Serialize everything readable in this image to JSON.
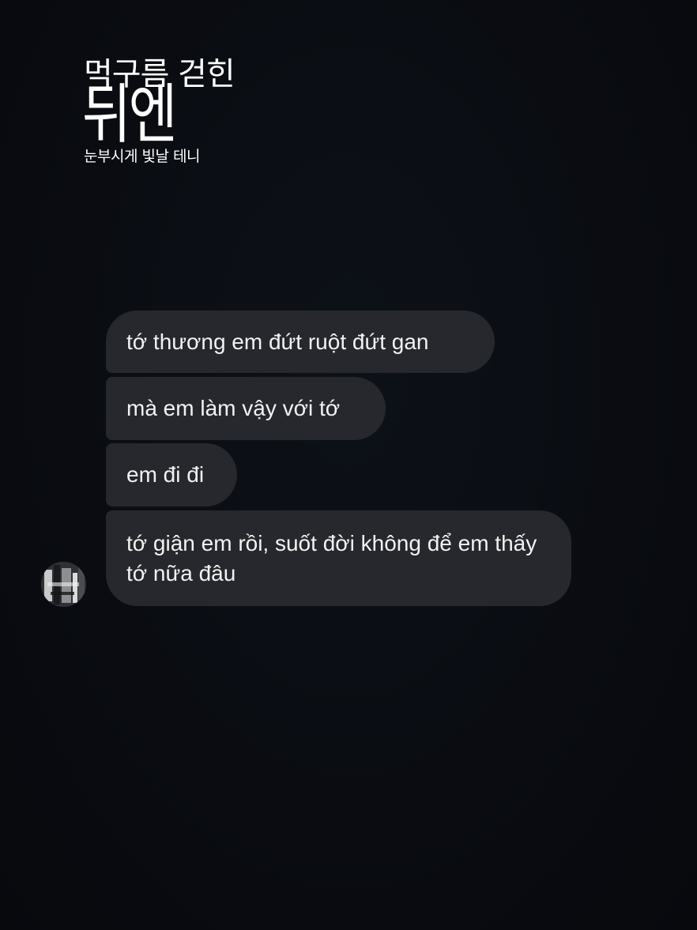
{
  "overlay": {
    "line1": "먹구름 걷힌",
    "line2": "뒤엔",
    "line3": "눈부시게 빛날 테니"
  },
  "conversation": {
    "messages": [
      {
        "text": "tớ thương em đứt ruột đứt gan"
      },
      {
        "text": "mà em làm vậy với tớ"
      },
      {
        "text": "em đi đi"
      },
      {
        "text": "tớ giận em rồi, suốt đời không để em thấy tớ nữa đâu"
      }
    ],
    "avatar_icon": "contact-avatar"
  },
  "colors": {
    "background": "#0a0d12",
    "bubble": "#26282d",
    "text": "#f2f2f2"
  }
}
